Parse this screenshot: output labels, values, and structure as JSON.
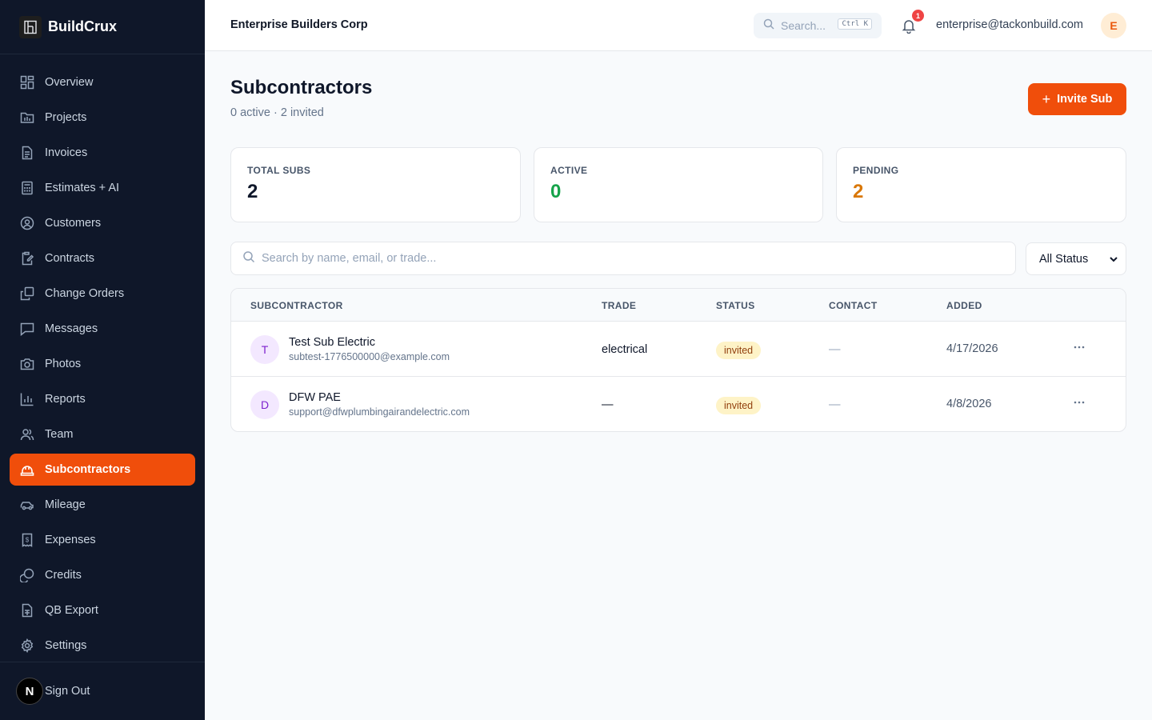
{
  "brand": {
    "name": "BuildCrux"
  },
  "sidebar": {
    "items": [
      {
        "label": "Overview",
        "icon": "grid-icon"
      },
      {
        "label": "Projects",
        "icon": "folder-icon"
      },
      {
        "label": "Invoices",
        "icon": "file-text-icon"
      },
      {
        "label": "Estimates + AI",
        "icon": "calculator-icon"
      },
      {
        "label": "Customers",
        "icon": "user-circle-icon"
      },
      {
        "label": "Contracts",
        "icon": "clipboard-pen-icon"
      },
      {
        "label": "Change Orders",
        "icon": "copy-icon"
      },
      {
        "label": "Messages",
        "icon": "message-square-icon"
      },
      {
        "label": "Photos",
        "icon": "camera-icon"
      },
      {
        "label": "Reports",
        "icon": "bar-chart-icon"
      },
      {
        "label": "Team",
        "icon": "users-icon"
      },
      {
        "label": "Subcontractors",
        "icon": "hard-hat-icon",
        "active": true
      },
      {
        "label": "Mileage",
        "icon": "car-icon"
      },
      {
        "label": "Expenses",
        "icon": "receipt-icon"
      },
      {
        "label": "Credits",
        "icon": "coins-icon"
      },
      {
        "label": "QB Export",
        "icon": "file-spreadsheet-icon"
      },
      {
        "label": "Settings",
        "icon": "gear-icon"
      }
    ],
    "sign_out": "Sign Out",
    "sign_out_badge": "N"
  },
  "header": {
    "org_name": "Enterprise Builders Corp",
    "search_placeholder": "Search...",
    "search_shortcut": "Ctrl K",
    "notification_count": "1",
    "user_email": "enterprise@tackonbuild.com",
    "avatar_initial": "E"
  },
  "main": {
    "title": "Subcontractors",
    "subtitle": "0 active · 2 invited",
    "invite_button": "Invite Sub",
    "stats": [
      {
        "label": "TOTAL SUBS",
        "value": "2",
        "color": "#0f172a"
      },
      {
        "label": "ACTIVE",
        "value": "0",
        "color": "#16a34a"
      },
      {
        "label": "PENDING",
        "value": "2",
        "color": "#d97706"
      }
    ],
    "search_placeholder": "Search by name, email, or trade...",
    "status_filter": "All Status",
    "table": {
      "headers": [
        "SUBCONTRACTOR",
        "TRADE",
        "STATUS",
        "CONTACT",
        "ADDED"
      ],
      "rows": [
        {
          "initial": "T",
          "name": "Test Sub Electric",
          "email": "subtest-1776500000@example.com",
          "trade": "electrical",
          "status": "invited",
          "contact": "—",
          "added": "4/17/2026"
        },
        {
          "initial": "D",
          "name": "DFW PAE",
          "email": "support@dfwplumbingairandelectric.com",
          "trade": "—",
          "status": "invited",
          "contact": "—",
          "added": "4/8/2026"
        }
      ]
    }
  },
  "colors": {
    "accent": "#f04e0b",
    "sidebar_bg": "#0f1729"
  }
}
